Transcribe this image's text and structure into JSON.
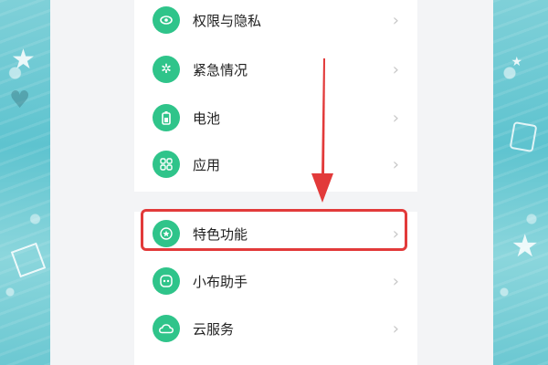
{
  "menu": {
    "items": [
      {
        "label": "权限与隐私",
        "icon": "privacy-icon"
      },
      {
        "label": "紧急情况",
        "icon": "emergency-icon"
      },
      {
        "label": "电池",
        "icon": "battery-icon"
      },
      {
        "label": "应用",
        "icon": "apps-icon"
      },
      {
        "label": "特色功能",
        "icon": "star-icon"
      },
      {
        "label": "小布助手",
        "icon": "assistant-icon"
      },
      {
        "label": "云服务",
        "icon": "cloud-icon"
      }
    ],
    "highlighted_item": "特色功能"
  },
  "colors": {
    "icon_bg": "#2fc48a",
    "highlight": "#e23a3a",
    "arrow": "#e23a3a"
  }
}
